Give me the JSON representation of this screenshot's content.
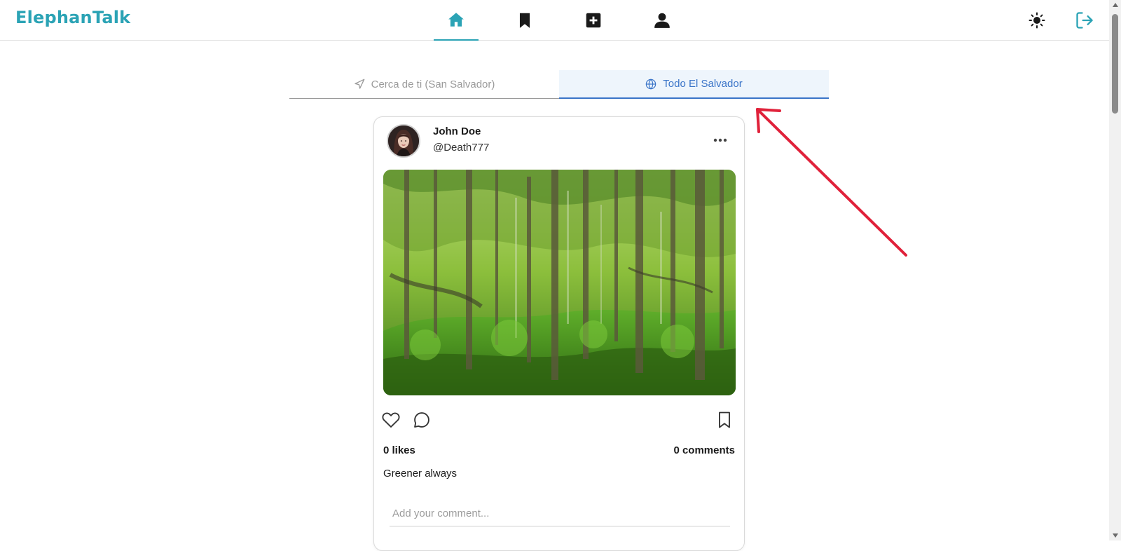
{
  "app": {
    "brand": "ElephanTalk"
  },
  "nav": {
    "items": [
      {
        "name": "home",
        "icon": "home-icon",
        "active": true
      },
      {
        "name": "saved",
        "icon": "bookmark-icon",
        "active": false
      },
      {
        "name": "create",
        "icon": "plus-square-icon",
        "active": false
      },
      {
        "name": "profile",
        "icon": "user-icon",
        "active": false
      }
    ],
    "theme_icon": "sun-icon",
    "logout_icon": "logout-icon"
  },
  "tabs": [
    {
      "label": "Cerca de ti (San Salvador)",
      "icon": "navigation-arrow-icon",
      "active": false
    },
    {
      "label": "Todo El Salvador",
      "icon": "globe-icon",
      "active": true
    }
  ],
  "post": {
    "author_name": "John Doe",
    "author_handle": "@Death777",
    "likes": "0 likes",
    "comments": "0 comments",
    "caption": "Greener always",
    "comment_placeholder": "Add your comment..."
  },
  "colors": {
    "brand": "#2ba3b5",
    "tab_active": "#3a74c8",
    "annotation": "#e0213a"
  }
}
